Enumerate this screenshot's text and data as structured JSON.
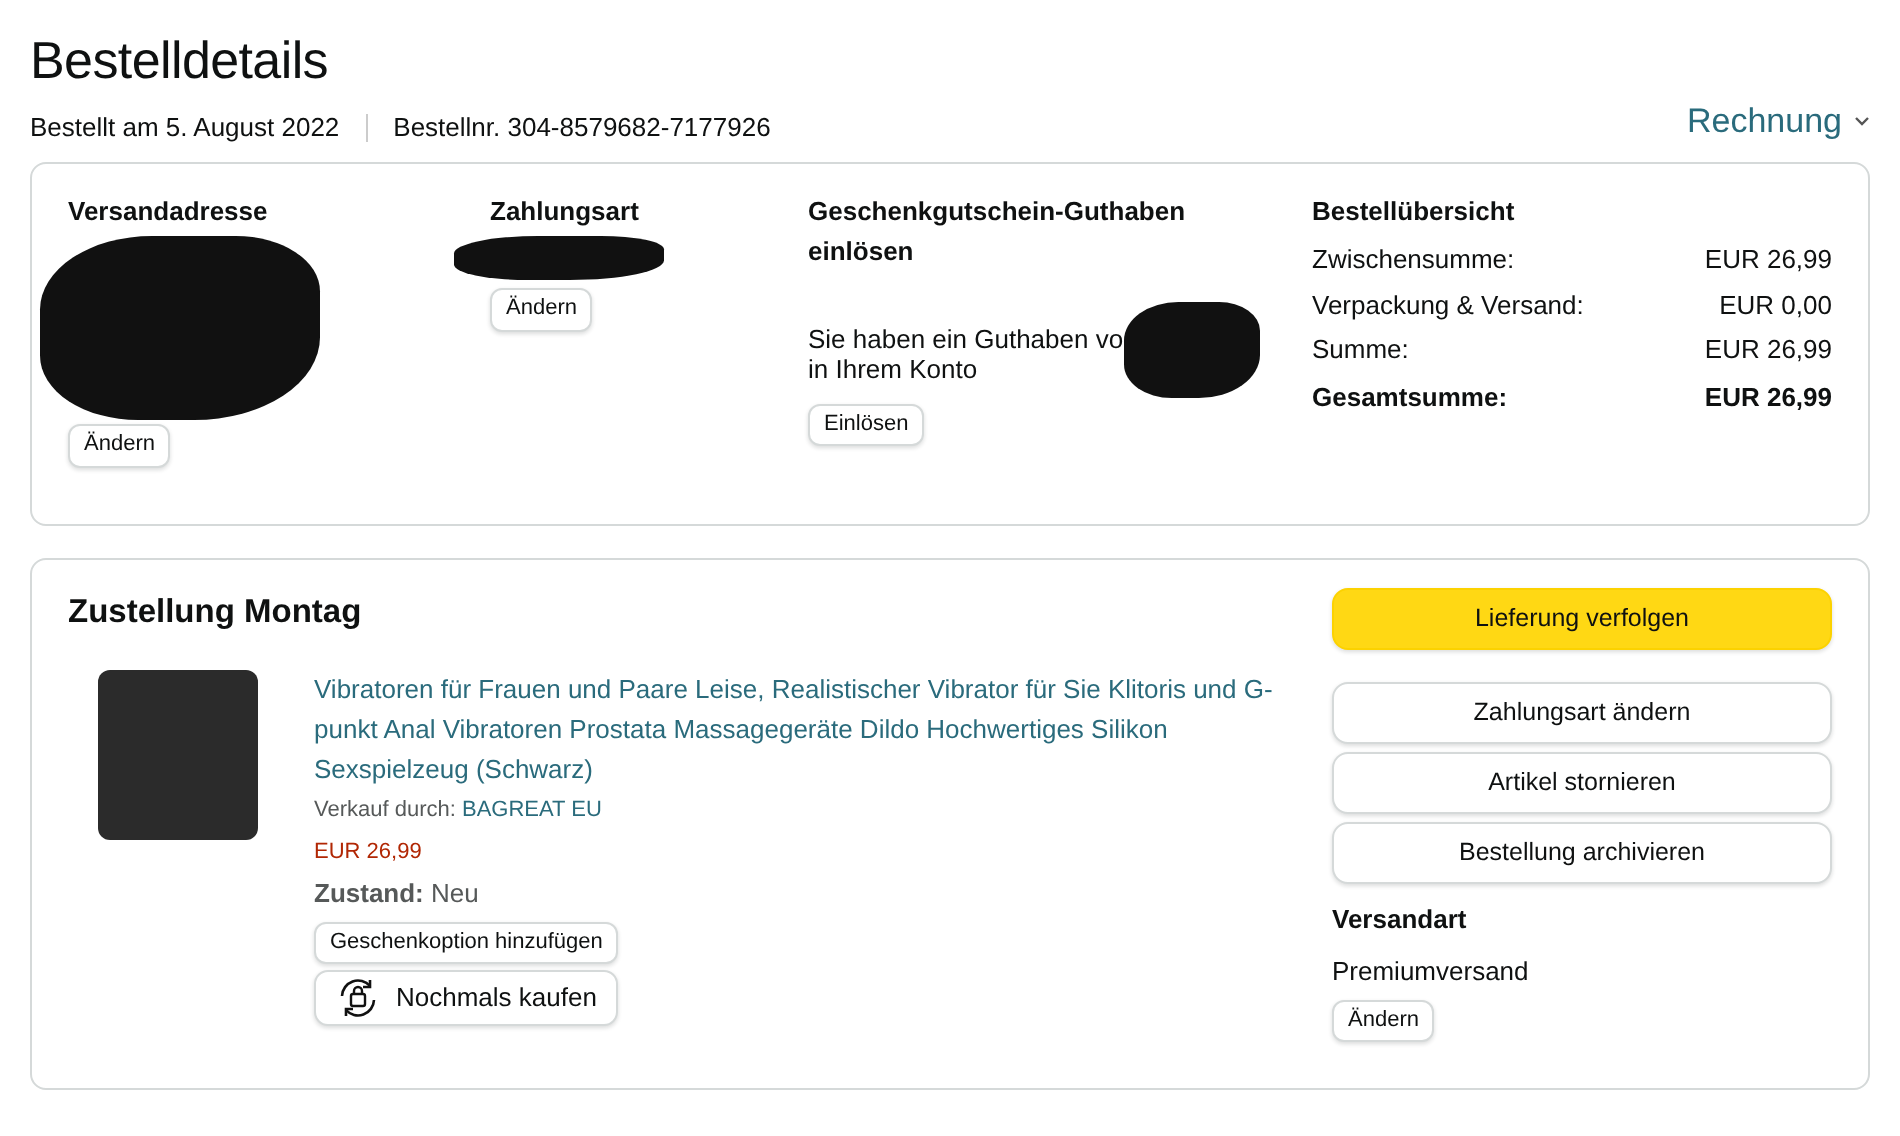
{
  "page_title": "Bestelldetails",
  "order_meta": [
    "Bestellt am 5. August 2022",
    "Bestellnr. 304-8579682-7177926"
  ],
  "invoice_link": "Rechnung",
  "summary_card": {
    "shipping_address": {
      "heading": "Versandadresse",
      "button": "Ändern"
    },
    "payment_method": {
      "heading": "Zahlungsart",
      "button": "Ändern"
    },
    "gift_card": {
      "heading": "Geschenkgutschein-Guthaben einlösen",
      "text_line_1": "Sie haben ein Guthaben vo",
      "text_line_2": "in Ihrem Konto",
      "button": "Einlösen"
    },
    "order_summary": {
      "heading": "Bestellübersicht",
      "rows": [
        {
          "label": "Zwischensumme:",
          "value": "EUR 26,99",
          "total": false
        },
        {
          "label": "Verpackung & Versand:",
          "value": "EUR 0,00",
          "total": false
        },
        {
          "label": "Summe:",
          "value": "EUR 26,99",
          "total": false
        },
        {
          "label": "Gesamtsumme:",
          "value": "EUR 26,99",
          "total": true
        }
      ]
    }
  },
  "shipment_card": {
    "heading": "Zustellung Montag",
    "item": {
      "title": "Vibratoren für Frauen und Paare Leise, Realistischer Vibrator für Sie Klitoris und G-punkt Anal Vibratoren Prostata Massagegeräte Dildo Hochwertiges Silikon Sexspielzeug (Schwarz)",
      "seller_label": "Verkauf durch:",
      "seller": "BAGREAT EU",
      "price": "EUR 26,99",
      "condition": "**Zustand:** Neu",
      "gift_button": "Geschenkoption hinzufügen",
      "buy_again_button": "Nochmals kaufen"
    },
    "actions": [
      {
        "label": "Lieferung verfolgen",
        "kind": "primary"
      },
      {
        "label": "Zahlungsart ändern",
        "kind": "secondary"
      },
      {
        "label": "Artikel stornieren",
        "kind": "secondary"
      },
      {
        "label": "Bestellung archivieren",
        "kind": "secondary"
      }
    ],
    "shipping_method": {
      "heading": "Versandart",
      "value": "Premiumversand",
      "button": "Ändern"
    }
  }
}
